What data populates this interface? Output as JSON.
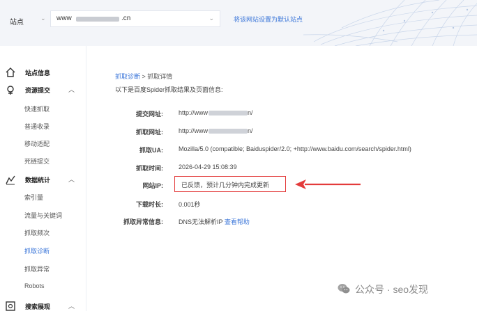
{
  "topbar": {
    "site_label": "站点",
    "site_caret": "⌄",
    "site_prefix": "www",
    "site_suffix": ".cn",
    "select_caret": "⌄",
    "default_site_link": "将该网站设置为默认站点"
  },
  "sidebar": {
    "sections": [
      {
        "label": "站点信息",
        "icon": "home-icon",
        "chevron": ""
      },
      {
        "label": "资源提交",
        "icon": "submit-icon",
        "chevron": "︿"
      },
      {
        "label": "数据统计",
        "icon": "stats-icon",
        "chevron": "︿"
      },
      {
        "label": "搜索展现",
        "icon": "search-display-icon",
        "chevron": "︿"
      }
    ],
    "items": [
      {
        "label": "快速抓取",
        "active": false
      },
      {
        "label": "普通收录",
        "active": false
      },
      {
        "label": "移动适配",
        "active": false
      },
      {
        "label": "死链提交",
        "active": false
      },
      {
        "label": "索引量",
        "active": false
      },
      {
        "label": "流量与关键词",
        "active": false
      },
      {
        "label": "抓取频次",
        "active": false
      },
      {
        "label": "抓取诊断",
        "active": true
      },
      {
        "label": "抓取异常",
        "active": false
      },
      {
        "label": "Robots",
        "active": false
      }
    ]
  },
  "main": {
    "breadcrumb": {
      "parent": "抓取诊断",
      "separator": " > ",
      "current": "抓取详情"
    },
    "intro": "以下是百度Spider抓取结果及页面信息:",
    "fields": {
      "submit_url": {
        "key": "提交网址:",
        "prefix": "http://www",
        "suffix": "n/"
      },
      "crawl_url": {
        "key": "抓取网址:",
        "prefix": "http://www",
        "suffix": "n/"
      },
      "ua": {
        "key": "抓取UA:",
        "value": "Mozilla/5.0 (compatible; Baiduspider/2.0; +http://www.baidu.com/search/spider.html)"
      },
      "crawl_time": {
        "key": "抓取时间:",
        "value": "2026-04-29 15:08:39"
      },
      "site_ip": {
        "key": "网站IP:",
        "value": "已反馈，预计几分钟内完成更新"
      },
      "download_time": {
        "key": "下载时长:",
        "value": "0.001秒"
      },
      "crawl_error": {
        "key": "抓取异常信息:",
        "value": "DNS无法解析IP",
        "link": "查看帮助"
      }
    }
  },
  "watermark": {
    "icon": "wechat-icon",
    "text": "公众号 · seo发现"
  },
  "colors": {
    "accent": "#3b76d9",
    "highlight": "#e33b3b",
    "topbar_bg": "#f3f5f9"
  }
}
